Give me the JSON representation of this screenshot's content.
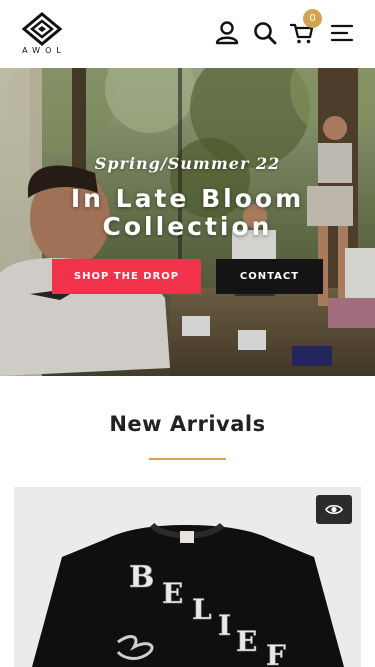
{
  "header": {
    "logo_text": "AWOL",
    "cart_count": "0",
    "icons": [
      "account-icon",
      "search-icon",
      "cart-icon",
      "menu-icon"
    ],
    "badge_color": "#d4a251"
  },
  "hero": {
    "subtitle": "Spring/Summer 22",
    "title_line1": "In Late Bloom",
    "title_line2": "Collection",
    "shop_label": "SHOP THE DROP",
    "contact_label": "CONTACT",
    "shop_color": "#f0334a",
    "contact_color": "#141414"
  },
  "arrivals": {
    "title": "New Arrivals",
    "accent": "#d4a251",
    "product_graphic_text": "BELIEF",
    "quick_view_icon": "eye-icon"
  }
}
